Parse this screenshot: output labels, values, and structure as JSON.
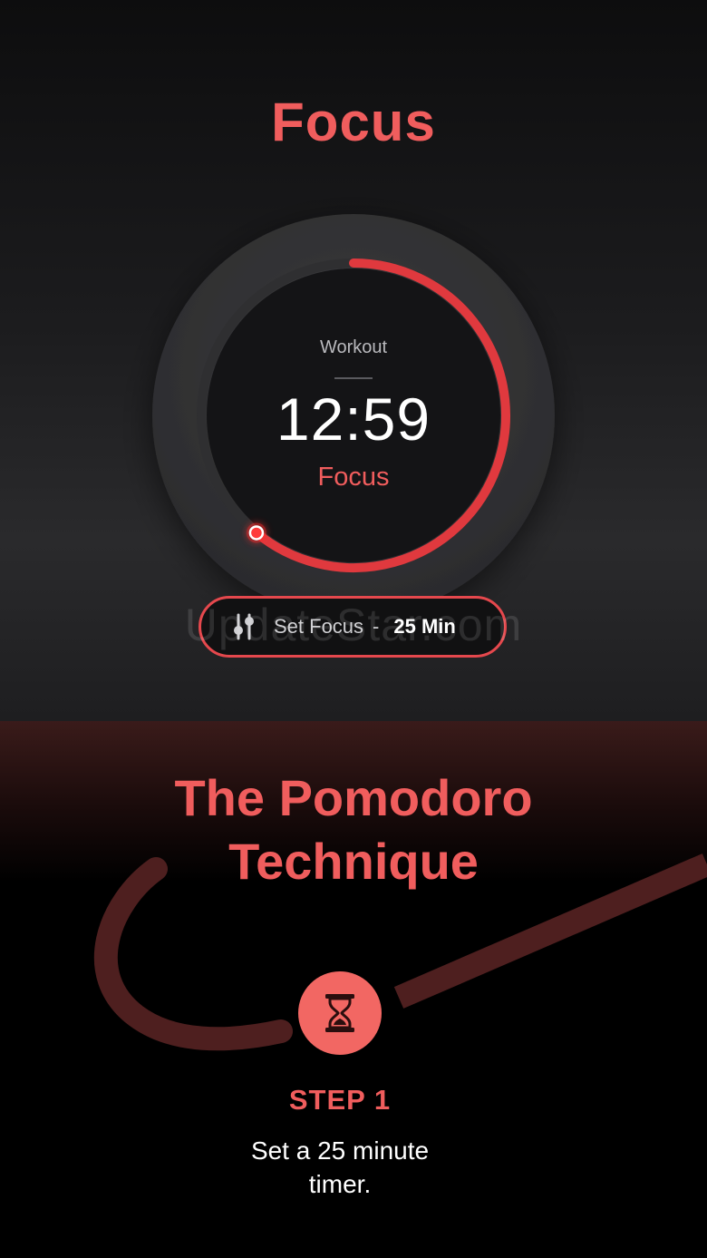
{
  "top": {
    "title": "Focus",
    "timer": {
      "mode": "Workout",
      "time": "12:59",
      "state": "Focus",
      "progress": 0.61
    },
    "set_focus_button": {
      "label": "Set Focus",
      "separator": "-",
      "value": "25 Min"
    },
    "watermark": "UpdateStar.com"
  },
  "bottom": {
    "title_line1": "The Pomodoro",
    "title_line2": "Technique",
    "step": {
      "icon": "hourglass-icon",
      "label": "STEP 1",
      "desc_line1": "Set a 25 minute",
      "desc_line2": "timer."
    }
  },
  "colors": {
    "accent": "#f05d5d",
    "ring": "#e0393e",
    "step_circle": "#f26763",
    "track": "#3a3a3c"
  }
}
